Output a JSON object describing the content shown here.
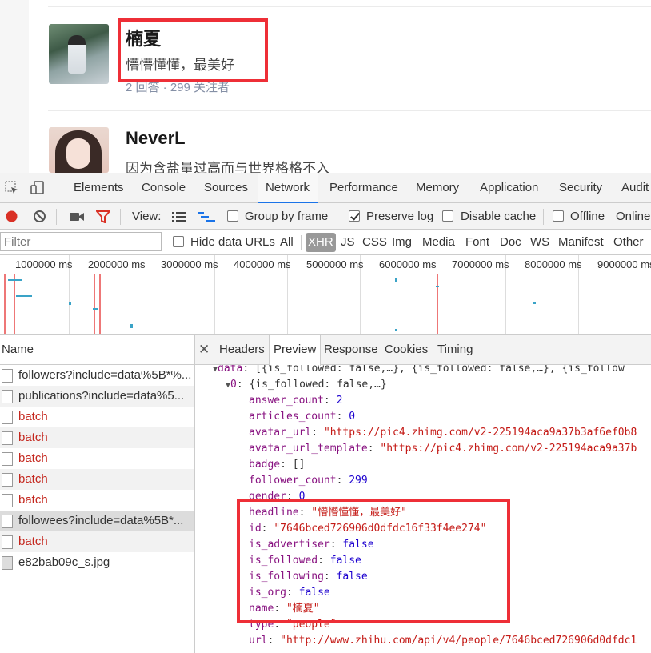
{
  "users": [
    {
      "name": "楠夏",
      "headline": "懵懵懂懂，最美好",
      "meta": "2 回答 · 299 关注者"
    },
    {
      "name": "NeverL",
      "headline": "因为含盐量过高而与世界格格不入"
    }
  ],
  "devtools": {
    "tabs": [
      "Elements",
      "Console",
      "Sources",
      "Network",
      "Performance",
      "Memory",
      "Application",
      "Security",
      "Audit"
    ],
    "selected_tab": "Network",
    "toolbar": {
      "view_label": "View:",
      "group_by_frame": "Group by frame",
      "preserve_log": "Preserve log",
      "disable_cache": "Disable cache",
      "offline": "Offline",
      "online": "Online"
    },
    "filter": {
      "placeholder": "Filter",
      "hide_data_urls": "Hide data URLs",
      "types": [
        "All",
        "XHR",
        "JS",
        "CSS",
        "Img",
        "Media",
        "Font",
        "Doc",
        "WS",
        "Manifest",
        "Other"
      ],
      "selected_type": "XHR"
    },
    "timeline_ticks": [
      "1000000 ms",
      "2000000 ms",
      "3000000 ms",
      "4000000 ms",
      "5000000 ms",
      "6000000 ms",
      "7000000 ms",
      "8000000 ms",
      "9000000 ms"
    ],
    "name_header": "Name",
    "requests": [
      {
        "name": "followers?include=data%5B*%...",
        "status": "normal"
      },
      {
        "name": "publications?include=data%5...",
        "status": "normal"
      },
      {
        "name": "batch",
        "status": "error"
      },
      {
        "name": "batch",
        "status": "error"
      },
      {
        "name": "batch",
        "status": "error"
      },
      {
        "name": "batch",
        "status": "error"
      },
      {
        "name": "batch",
        "status": "error"
      },
      {
        "name": "followees?include=data%5B*...",
        "status": "selected"
      },
      {
        "name": "batch",
        "status": "error"
      },
      {
        "name": "e82bab09c_s.jpg",
        "status": "normal"
      }
    ],
    "detail_tabs": [
      "Headers",
      "Preview",
      "Response",
      "Cookies",
      "Timing"
    ],
    "selected_detail_tab": "Preview",
    "preview": {
      "data_line": "[{is_followed: false,…}, {is_followed: false,…}, {is_follow",
      "item0_summary": "{is_followed: false,…}",
      "answer_count": "2",
      "articles_count": "0",
      "avatar_url": "\"https://pic4.zhimg.com/v2-225194aca9a37b3af6ef0b8",
      "avatar_url_template": "\"https://pic4.zhimg.com/v2-225194aca9a37b",
      "badge": "[]",
      "follower_count": "299",
      "gender": "0",
      "headline": "\"懵懵懂懂，最美好\"",
      "id": "\"7646bced726906d0dfdc16f33f4ee274\"",
      "is_advertiser": "false",
      "is_followed": "false",
      "is_following": "false",
      "is_org": "false",
      "name": "\"楠夏\"",
      "type": "\"people\"",
      "url": "\"http://www.zhihu.com/api/v4/people/7646bced726906d0dfdc1"
    }
  },
  "colors": {
    "highlight_box": "#ee2f37",
    "record": "#d93025",
    "filter_icon": "#d93025",
    "key": "#881280",
    "string": "#c41a16",
    "number": "#1c00cf"
  }
}
